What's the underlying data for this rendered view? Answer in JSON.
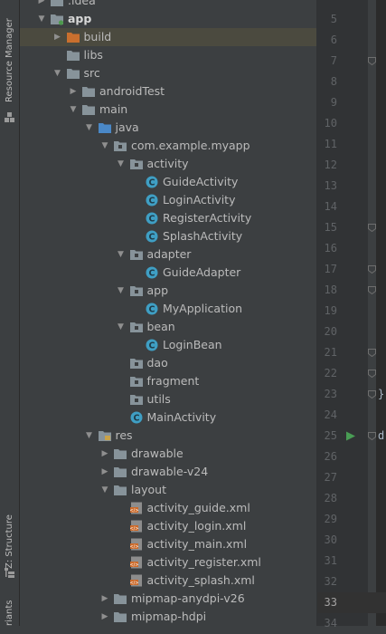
{
  "sidebar": {
    "tabs": [
      {
        "label": "Resource Manager"
      },
      {
        "label": "Z: Structure"
      },
      {
        "label": "riants"
      }
    ]
  },
  "tree": {
    "items": [
      {
        "label": ".idea",
        "depth": 1,
        "arrow": "right",
        "icon": "folder-icon"
      },
      {
        "label": "app",
        "depth": 1,
        "arrow": "down",
        "icon": "module-folder-icon",
        "bold": true
      },
      {
        "label": "build",
        "depth": 2,
        "arrow": "right",
        "icon": "orange-folder-icon",
        "selected": true
      },
      {
        "label": "libs",
        "depth": 2,
        "arrow": "",
        "icon": "folder-icon"
      },
      {
        "label": "src",
        "depth": 2,
        "arrow": "down",
        "icon": "folder-icon"
      },
      {
        "label": "androidTest",
        "depth": 3,
        "arrow": "right",
        "icon": "folder-icon"
      },
      {
        "label": "main",
        "depth": 3,
        "arrow": "down",
        "icon": "folder-icon"
      },
      {
        "label": "java",
        "depth": 4,
        "arrow": "down",
        "icon": "source-folder-icon"
      },
      {
        "label": "com.example.myapp",
        "depth": 5,
        "arrow": "down",
        "icon": "package-icon"
      },
      {
        "label": "activity",
        "depth": 6,
        "arrow": "down",
        "icon": "package-icon"
      },
      {
        "label": "GuideActivity",
        "depth": 7,
        "arrow": "",
        "icon": "class-icon"
      },
      {
        "label": "LoginActivity",
        "depth": 7,
        "arrow": "",
        "icon": "class-icon"
      },
      {
        "label": "RegisterActivity",
        "depth": 7,
        "arrow": "",
        "icon": "class-icon"
      },
      {
        "label": "SplashActivity",
        "depth": 7,
        "arrow": "",
        "icon": "class-icon"
      },
      {
        "label": "adapter",
        "depth": 6,
        "arrow": "down",
        "icon": "package-icon"
      },
      {
        "label": "GuideAdapter",
        "depth": 7,
        "arrow": "",
        "icon": "class-icon"
      },
      {
        "label": "app",
        "depth": 6,
        "arrow": "down",
        "icon": "package-icon"
      },
      {
        "label": "MyApplication",
        "depth": 7,
        "arrow": "",
        "icon": "class-icon"
      },
      {
        "label": "bean",
        "depth": 6,
        "arrow": "down",
        "icon": "package-icon"
      },
      {
        "label": "LoginBean",
        "depth": 7,
        "arrow": "",
        "icon": "class-icon"
      },
      {
        "label": "dao",
        "depth": 6,
        "arrow": "",
        "icon": "package-icon"
      },
      {
        "label": "fragment",
        "depth": 6,
        "arrow": "",
        "icon": "package-icon"
      },
      {
        "label": "utils",
        "depth": 6,
        "arrow": "",
        "icon": "package-icon"
      },
      {
        "label": "MainActivity",
        "depth": 6,
        "arrow": "",
        "icon": "class-icon"
      },
      {
        "label": "res",
        "depth": 4,
        "arrow": "down",
        "icon": "resource-folder-icon"
      },
      {
        "label": "drawable",
        "depth": 5,
        "arrow": "right",
        "icon": "folder-icon"
      },
      {
        "label": "drawable-v24",
        "depth": 5,
        "arrow": "right",
        "icon": "folder-icon"
      },
      {
        "label": "layout",
        "depth": 5,
        "arrow": "down",
        "icon": "folder-icon"
      },
      {
        "label": "activity_guide.xml",
        "depth": 6,
        "arrow": "",
        "icon": "layout-xml-icon"
      },
      {
        "label": "activity_login.xml",
        "depth": 6,
        "arrow": "",
        "icon": "layout-xml-icon"
      },
      {
        "label": "activity_main.xml",
        "depth": 6,
        "arrow": "",
        "icon": "layout-xml-icon"
      },
      {
        "label": "activity_register.xml",
        "depth": 6,
        "arrow": "",
        "icon": "layout-xml-icon"
      },
      {
        "label": "activity_splash.xml",
        "depth": 6,
        "arrow": "",
        "icon": "layout-xml-icon"
      },
      {
        "label": "mipmap-anydpi-v26",
        "depth": 5,
        "arrow": "right",
        "icon": "folder-icon"
      },
      {
        "label": "mipmap-hdpi",
        "depth": 5,
        "arrow": "right",
        "icon": "folder-icon"
      }
    ]
  },
  "editor": {
    "line_numbers": [
      "5",
      "6",
      "7",
      "8",
      "9",
      "10",
      "11",
      "12",
      "13",
      "14",
      "15",
      "16",
      "17",
      "18",
      "19",
      "20",
      "21",
      "22",
      "23",
      "24",
      "25",
      "26",
      "27",
      "28",
      "29",
      "30",
      "31",
      "32",
      "33",
      "34"
    ],
    "current_line": "33",
    "run_line": "25",
    "fold_lines": [
      "7",
      "15",
      "17",
      "18",
      "21",
      "22",
      "23",
      "25"
    ],
    "code_fragments": [
      {
        "line": "23",
        "text": "}"
      },
      {
        "line": "25",
        "text": "d"
      }
    ]
  },
  "colors": {
    "folder": "#87939a",
    "orange_folder": "#c96f2e",
    "class": "#3f9fc4",
    "source_folder": "#4a88c7",
    "run": "#499c54"
  }
}
